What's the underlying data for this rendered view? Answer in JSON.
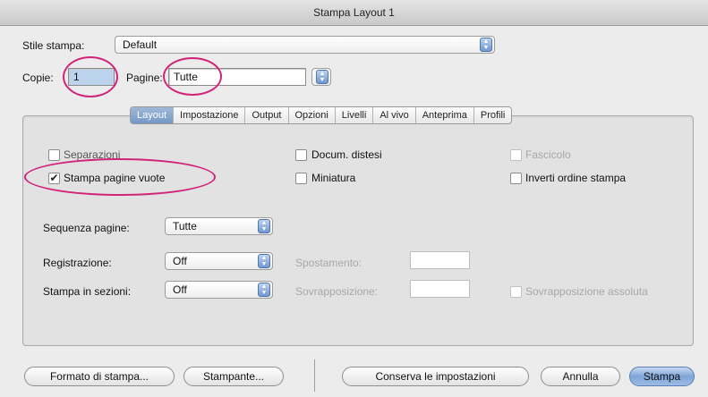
{
  "window": {
    "title": "Stampa Layout 1"
  },
  "print_style": {
    "label": "Stile stampa:",
    "value": "Default"
  },
  "copies": {
    "label": "Copie:",
    "value": "1"
  },
  "pages": {
    "label": "Pagine:",
    "value": "Tutte"
  },
  "tabs": [
    "Layout",
    "Impostazione",
    "Output",
    "Opzioni",
    "Livelli",
    "Al vivo",
    "Anteprima",
    "Profili"
  ],
  "active_tab": "Layout",
  "options": {
    "separazioni": {
      "label": "Separazioni",
      "checked": false
    },
    "stampa_pagine_vuote": {
      "label": "Stampa pagine vuote",
      "checked": true
    },
    "docum_distesi": {
      "label": "Docum. distesi",
      "checked": false
    },
    "miniatura": {
      "label": "Miniatura",
      "checked": false
    },
    "fascicolo": {
      "label": "Fascicolo",
      "checked": false,
      "enabled": false
    },
    "inverti_ordine": {
      "label": "Inverti ordine stampa",
      "checked": false
    }
  },
  "sequenza_pagine": {
    "label": "Sequenza pagine:",
    "value": "Tutte"
  },
  "registrazione": {
    "label": "Registrazione:",
    "value": "Off"
  },
  "stampa_in_sezioni": {
    "label": "Stampa in sezioni:",
    "value": "Off"
  },
  "spostamento": {
    "label": "Spostamento:",
    "value": ""
  },
  "sovrapposizione": {
    "label": "Sovrapposizione:",
    "value": ""
  },
  "sovrapposizione_assoluta": {
    "label": "Sovrapposizione assoluta",
    "checked": false
  },
  "buttons": {
    "formato": "Formato di stampa...",
    "stampante": "Stampante...",
    "conserva": "Conserva le impostazioni",
    "annulla": "Annulla",
    "stampa": "Stampa"
  },
  "colors": {
    "highlight": "#d2237a",
    "accent": "#7398c7"
  }
}
